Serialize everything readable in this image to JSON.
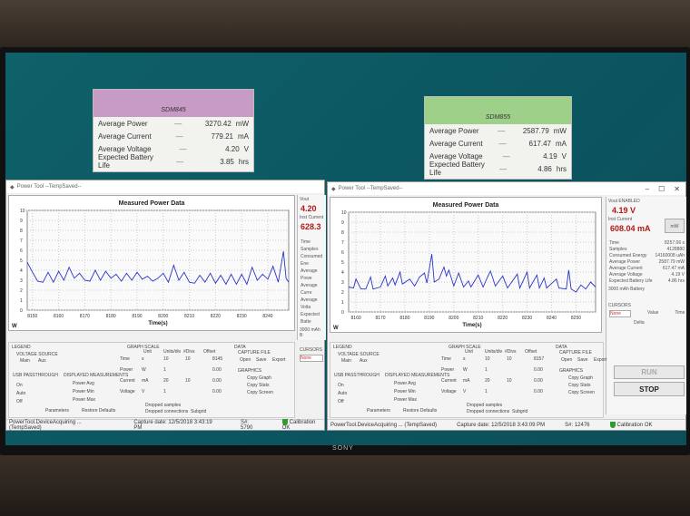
{
  "cards": [
    {
      "title": "SDM845",
      "color": "#c79bc6",
      "rows": [
        {
          "label": "Average Power",
          "value": "3270.42",
          "unit": "mW"
        },
        {
          "label": "Average Current",
          "value": "779.21",
          "unit": "mA"
        },
        {
          "label": "Average Voltage",
          "value": "4.20",
          "unit": "V"
        },
        {
          "label": "Expected Battery Life",
          "value": "3.85",
          "unit": "hrs"
        }
      ]
    },
    {
      "title": "SDM855",
      "color": "#9fd08a",
      "rows": [
        {
          "label": "Average Power",
          "value": "2587.79",
          "unit": "mW"
        },
        {
          "label": "Average Current",
          "value": "617.47",
          "unit": "mA"
        },
        {
          "label": "Average Voltage",
          "value": "4.19",
          "unit": "V"
        },
        {
          "label": "Expected Battery Life",
          "value": "4.86",
          "unit": "hrs"
        }
      ]
    }
  ],
  "windows": [
    {
      "title": "Power Tool --TempSaved--",
      "chart_title": "Measured Power Data",
      "xlabel": "Time(s)",
      "ylabel": "W",
      "vout_label": "Vout",
      "vout": "4.20",
      "inst_label": "Inst Current",
      "inst": "628.3",
      "stats": [
        "Time",
        "Samples",
        "Consumed Ene",
        "Average Powe",
        "Average Curre",
        "Average Volta",
        "Expected Batte"
      ],
      "battery": "3000 mAh B",
      "cursors": "CURSORS",
      "cursor_sel": "None",
      "status": "PowerTool.DeviceAcquiring ... (TempSaved)",
      "capture": "Capture date: 12/5/2018 3:43:19 PM",
      "sn": "S#: 5790",
      "cal": "Calibration OK",
      "offset": "8145"
    },
    {
      "title": "Power Tool --TempSaved--",
      "chart_title": "Measured Power Data",
      "xlabel": "Time(s)",
      "ylabel": "W",
      "vout_label": "Vout ENABLED",
      "vout": "4.19  V",
      "inst_label": "Inst Current",
      "inst": "608.04  mA",
      "mw": "mW",
      "stats": [
        "Time",
        "Samples",
        "Consumed Energy",
        "Average Power",
        "Average Current",
        "Average Voltage",
        "Expected Battery Life"
      ],
      "stat_vals": [
        "8257.06 s",
        "4128880",
        "14160008 uAh",
        "2587.79 mW",
        "617.47 mA",
        "4.19 V",
        "4.86 hrs"
      ],
      "battery": "3000 mAh Battery",
      "cursors": "CURSORS",
      "cursor_sel": "None",
      "value": "Value",
      "time": "Time",
      "delta": "Delta",
      "run": "RUN",
      "stop": "STOP",
      "status": "PowerTool.DeviceAcquiring ... (TempSaved)",
      "capture": "Capture date: 12/5/2018 3:43:09 PM",
      "sn": "S#: 12476",
      "cal": "Calibration OK",
      "offset": "8157"
    }
  ],
  "controls": {
    "legend": "LEGEND",
    "voltage_source": "VOLTAGE SOURCE",
    "main": "Main",
    "aux": "Aux",
    "passthrough": "USB PASSTHROUGH",
    "on": "On",
    "auto": "Auto",
    "off": "Off",
    "displayed": "DISPLAYED MEASUREMENTS",
    "pavg": "Power Avg",
    "pmin": "Power Min",
    "pmax": "Power Max",
    "graph_scale": "GRAPH SCALE",
    "cols": [
      "Unit",
      "Units/div",
      "#Divs",
      "Offset"
    ],
    "rows": [
      [
        "Time",
        "s",
        "10",
        "10"
      ],
      [
        "Power",
        "W",
        "1",
        ""
      ],
      [
        "Current",
        "mA",
        "20",
        "10"
      ],
      [
        "Voltage",
        "V",
        "1",
        ""
      ]
    ],
    "zero": "0.00",
    "data": "DATA",
    "capture_file": "CAPTURE FILE",
    "open": "Open",
    "save": "Save",
    "export": "Export",
    "graphics": "GRAPHICS",
    "copy_graph": "Copy Graph",
    "copy_stats": "Copy Stats",
    "copy_screen": "Copy Screen",
    "parameters": "Parameters",
    "restore": "Restore Defaults",
    "dropped_samples": "Dropped samples",
    "dropped_conn": "Dropped connections",
    "subgrid": "Subgrid"
  },
  "chart_data": [
    {
      "type": "line",
      "title": "Measured Power Data",
      "xlabel": "Time(s)",
      "ylabel": "W",
      "ylim": [
        0,
        10
      ],
      "xlim": [
        8148,
        8248
      ],
      "xticks": [
        8150,
        8160,
        8170,
        8180,
        8190,
        8200,
        8210,
        8220,
        8230,
        8240
      ],
      "yticks": [
        0,
        1,
        2,
        3,
        4,
        5,
        6,
        7,
        8,
        9,
        10
      ],
      "grid": true,
      "x": [
        8148,
        8150,
        8152,
        8154,
        8156,
        8158,
        8160,
        8162,
        8164,
        8166,
        8168,
        8170,
        8172,
        8174,
        8176,
        8178,
        8180,
        8182,
        8184,
        8186,
        8188,
        8190,
        8192,
        8194,
        8196,
        8198,
        8200,
        8202,
        8204,
        8206,
        8208,
        8210,
        8212,
        8214,
        8216,
        8218,
        8220,
        8222,
        8224,
        8226,
        8228,
        8230,
        8232,
        8234,
        8236,
        8238,
        8240,
        8242,
        8244,
        8246,
        8247,
        8248
      ],
      "y": [
        4.8,
        3.8,
        2.9,
        2.8,
        3.8,
        2.8,
        3.9,
        3.0,
        4.3,
        3.2,
        3.7,
        3.0,
        2.9,
        4.0,
        3.0,
        3.9,
        3.2,
        3.6,
        2.9,
        3.7,
        3.0,
        3.8,
        3.1,
        3.4,
        2.9,
        3.2,
        3.7,
        2.8,
        4.5,
        3.0,
        3.8,
        2.8,
        2.7,
        3.5,
        2.8,
        3.7,
        2.7,
        3.5,
        2.6,
        3.6,
        2.6,
        3.6,
        2.6,
        4.3,
        3.0,
        3.6,
        3.1,
        4.4,
        2.8,
        5.9,
        3.2,
        2.8
      ]
    },
    {
      "type": "line",
      "title": "Measured Power Data",
      "xlabel": "Time(s)",
      "ylabel": "W",
      "ylim": [
        0,
        10
      ],
      "xlim": [
        8157,
        8258
      ],
      "xticks": [
        8160,
        8170,
        8180,
        8190,
        8200,
        8210,
        8220,
        8230,
        8240,
        8250
      ],
      "yticks": [
        0,
        1,
        2,
        3,
        4,
        5,
        6,
        7,
        8,
        9,
        10
      ],
      "grid": true,
      "x": [
        8157,
        8159,
        8160,
        8162,
        8164,
        8166,
        8167,
        8170,
        8172,
        8173,
        8175,
        8176,
        8178,
        8179,
        8182,
        8184,
        8186,
        8188,
        8189,
        8191,
        8192,
        8194,
        8196,
        8197,
        8198,
        8200,
        8202,
        8204,
        8206,
        8207,
        8210,
        8212,
        8214,
        8215,
        8217,
        8220,
        8222,
        8226,
        8227,
        8230,
        8231,
        8234,
        8235,
        8237,
        8238,
        8242,
        8243,
        8246,
        8247,
        8248,
        8250,
        8252,
        8254,
        8256,
        8258
      ],
      "y": [
        2.5,
        2.4,
        3.3,
        2.3,
        2.3,
        3.5,
        2.3,
        2.5,
        3.6,
        2.6,
        3.4,
        2.7,
        4.0,
        2.8,
        3.3,
        2.6,
        3.5,
        3.9,
        2.9,
        5.8,
        3.0,
        3.3,
        4.5,
        3.6,
        4.2,
        2.6,
        3.9,
        2.5,
        3.1,
        2.5,
        3.7,
        2.5,
        3.6,
        4.1,
        2.6,
        3.6,
        2.4,
        3.8,
        2.4,
        4.0,
        2.4,
        3.7,
        2.4,
        3.4,
        2.4,
        3.3,
        2.4,
        2.3,
        4.2,
        2.3,
        2.0,
        2.7,
        2.3,
        3.0,
        2.5
      ]
    }
  ],
  "monitor_brand": "SONY"
}
